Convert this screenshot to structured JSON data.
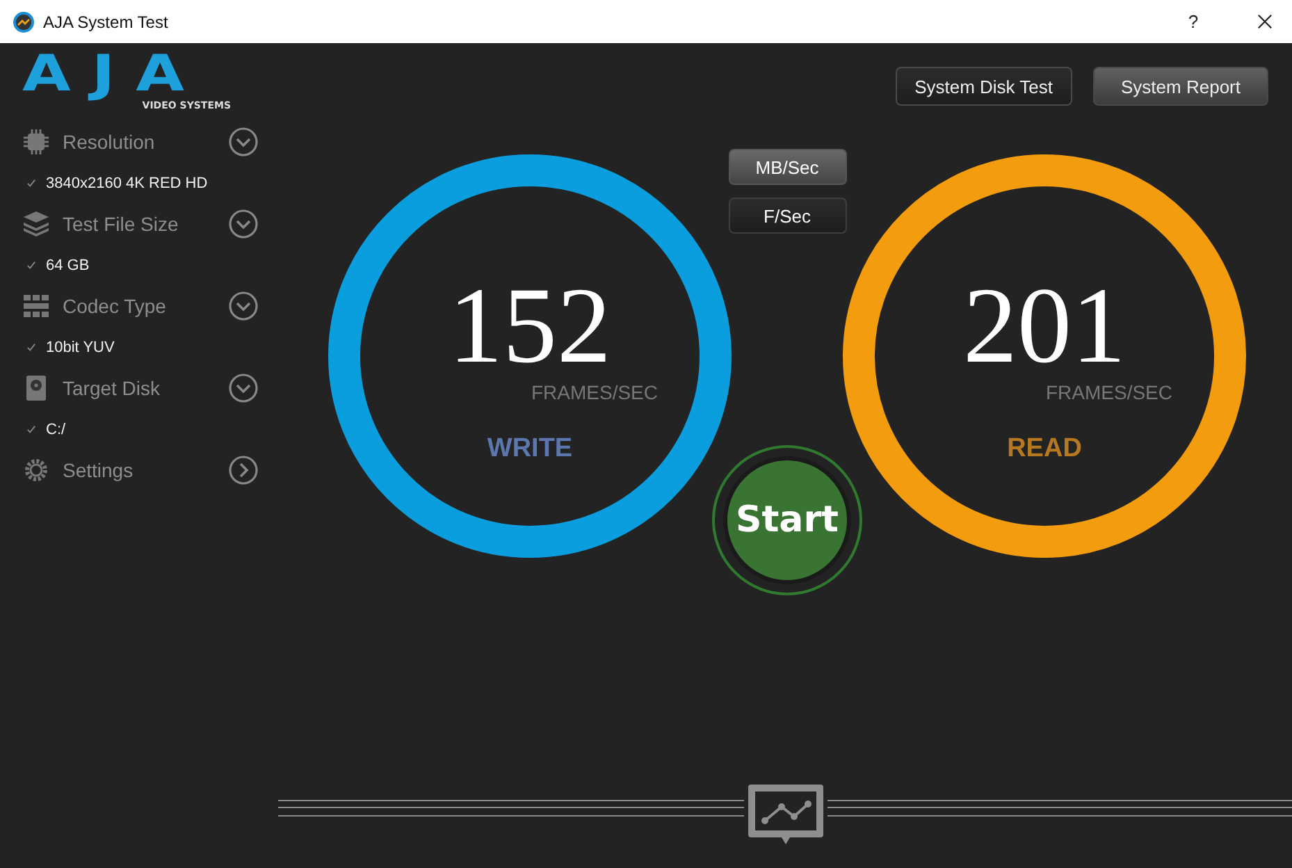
{
  "window": {
    "title": "AJA System Test",
    "help": "?"
  },
  "logo": {
    "brand": "AJA",
    "tagline": "VIDEO SYSTEMS"
  },
  "top_buttons": [
    "System Disk Test",
    "System Report"
  ],
  "sidebar": {
    "items": [
      {
        "kind": "dropdown",
        "label": "Resolution",
        "value": "3840x2160 4K RED HD"
      },
      {
        "kind": "dropdown",
        "label": "Test File Size",
        "value": "64 GB"
      },
      {
        "kind": "dropdown",
        "label": "Codec Type",
        "value": "10bit YUV"
      },
      {
        "kind": "dropdown",
        "label": "Target Disk",
        "value": "C:/"
      },
      {
        "kind": "page",
        "label": "Settings"
      }
    ]
  },
  "units": [
    {
      "label": "MB/Sec",
      "selected": false
    },
    {
      "label": "F/Sec",
      "selected": true
    }
  ],
  "gauges": [
    {
      "kind": "write",
      "value": "152",
      "unit": "FRAMES/SEC",
      "label": "WRITE",
      "color": "#0b9ede"
    },
    {
      "kind": "read",
      "value": "201",
      "unit": "FRAMES/SEC",
      "label": "READ",
      "color": "#f39c0d"
    }
  ],
  "start_button": "Start"
}
